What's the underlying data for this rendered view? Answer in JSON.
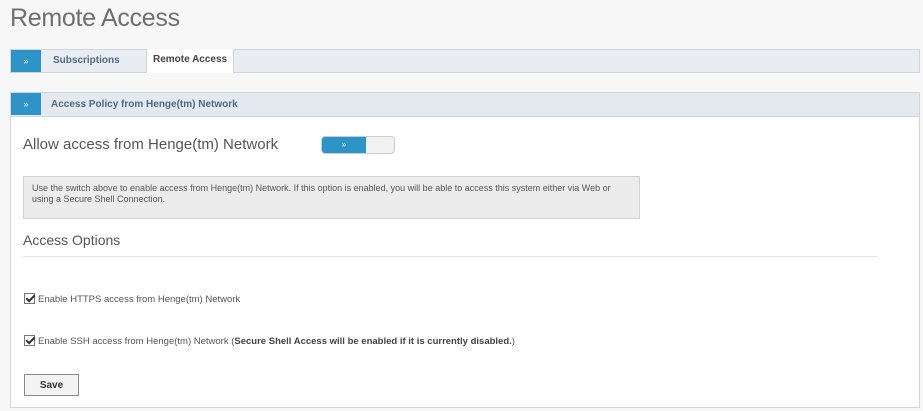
{
  "page": {
    "title": "Remote Access"
  },
  "tabs": {
    "chip_icon": "double-chevron-right",
    "items": [
      {
        "label": "Subscriptions",
        "active": false
      },
      {
        "label": "Remote Access",
        "active": true
      }
    ]
  },
  "panel": {
    "title": "Access Policy from Henge(tm) Network",
    "allow_label": "Allow access from Henge(tm) Network",
    "toggle": {
      "state": "on"
    },
    "help_text": "Use the switch above to enable access from Henge(tm) Network. If this option is enabled, you will be able to access this system either via Web or using a Secure Shell Connection.",
    "options_title": "Access Options",
    "options": {
      "https": {
        "label": "Enable HTTPS access from Henge(tm) Network",
        "checked": true
      },
      "ssh": {
        "label": "Enable SSH access from Henge(tm) Network (",
        "note": "Secure Shell Access will be enabled if it is currently disabled.",
        "suffix": ")",
        "checked": true
      }
    },
    "save_label": "Save"
  },
  "colors": {
    "accent": "#2e93c6",
    "header_bg": "#e4e9ef"
  }
}
